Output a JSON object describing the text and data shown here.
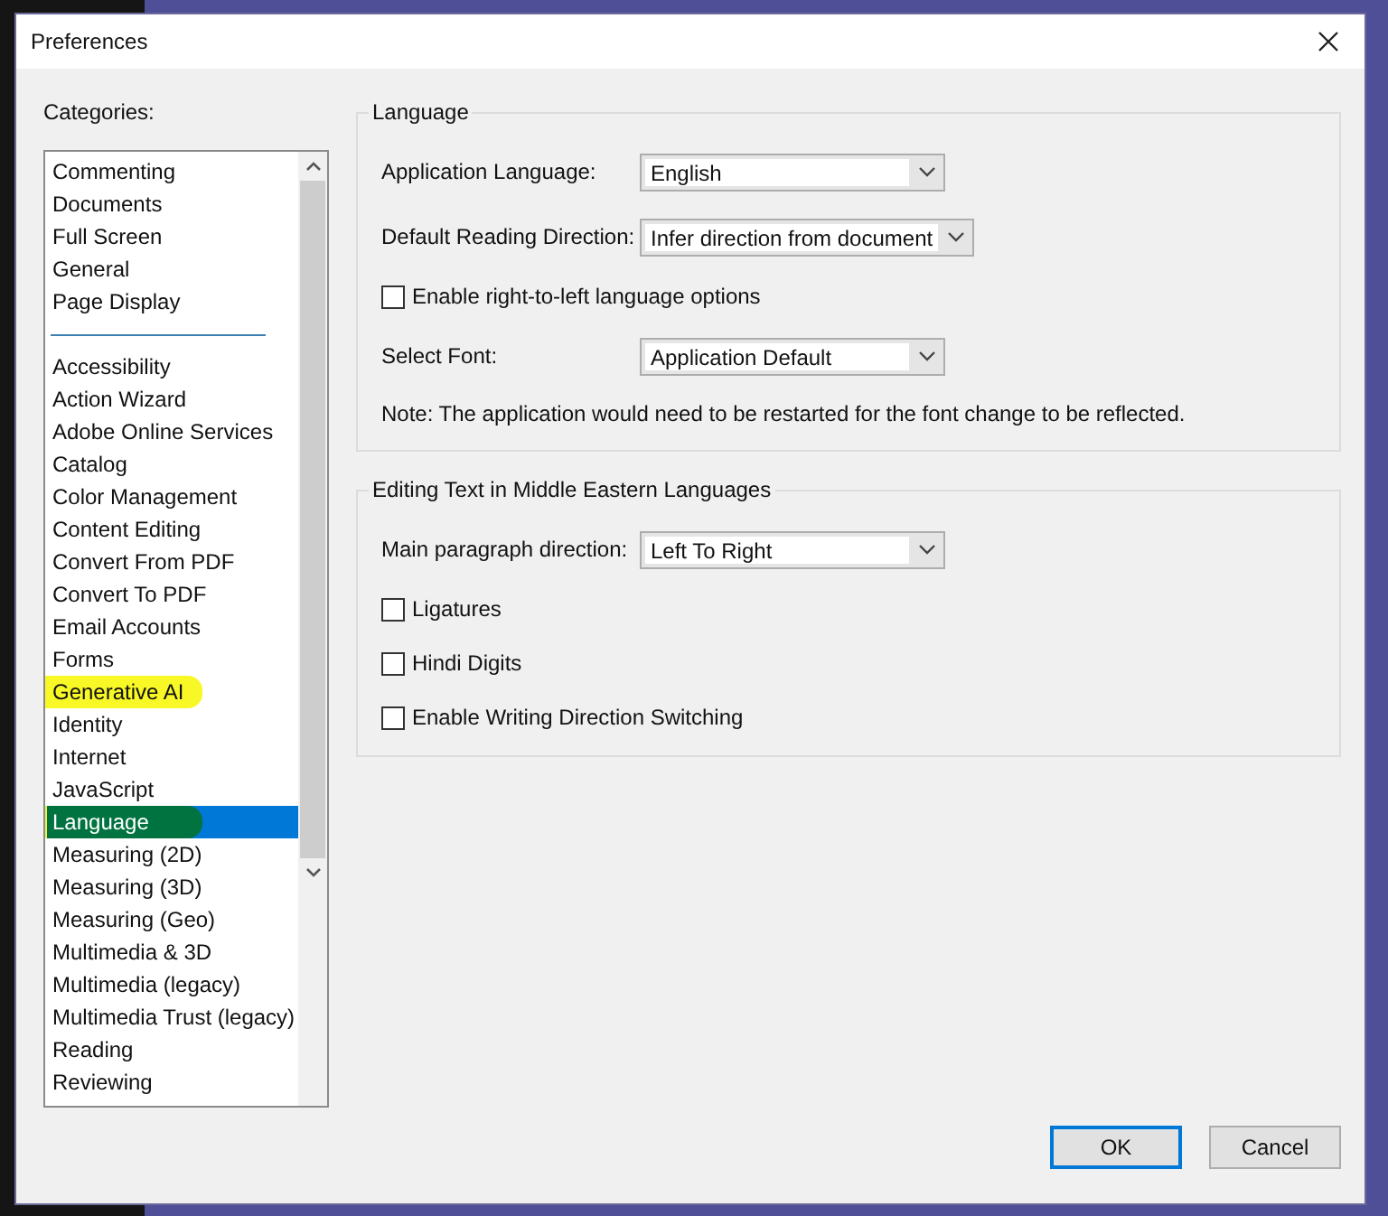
{
  "window": {
    "title": "Preferences"
  },
  "categories": {
    "label": "Categories:",
    "groups": [
      {
        "items": [
          {
            "label": "Commenting",
            "selected": false,
            "highlighted": false
          },
          {
            "label": "Documents",
            "selected": false,
            "highlighted": false
          },
          {
            "label": "Full Screen",
            "selected": false,
            "highlighted": false
          },
          {
            "label": "General",
            "selected": false,
            "highlighted": false
          },
          {
            "label": "Page Display",
            "selected": false,
            "highlighted": false
          }
        ]
      },
      {
        "items": [
          {
            "label": "Accessibility",
            "selected": false,
            "highlighted": false
          },
          {
            "label": "Action Wizard",
            "selected": false,
            "highlighted": false
          },
          {
            "label": "Adobe Online Services",
            "selected": false,
            "highlighted": false
          },
          {
            "label": "Catalog",
            "selected": false,
            "highlighted": false
          },
          {
            "label": "Color Management",
            "selected": false,
            "highlighted": false
          },
          {
            "label": "Content Editing",
            "selected": false,
            "highlighted": false
          },
          {
            "label": "Convert From PDF",
            "selected": false,
            "highlighted": false
          },
          {
            "label": "Convert To PDF",
            "selected": false,
            "highlighted": false
          },
          {
            "label": "Email Accounts",
            "selected": false,
            "highlighted": false
          },
          {
            "label": "Forms",
            "selected": false,
            "highlighted": false
          },
          {
            "label": "Generative AI",
            "selected": false,
            "highlighted": true
          },
          {
            "label": "Identity",
            "selected": false,
            "highlighted": false
          },
          {
            "label": "Internet",
            "selected": false,
            "highlighted": false
          },
          {
            "label": "JavaScript",
            "selected": false,
            "highlighted": false
          },
          {
            "label": "Language",
            "selected": true,
            "highlighted": true
          },
          {
            "label": "Measuring (2D)",
            "selected": false,
            "highlighted": false
          },
          {
            "label": "Measuring (3D)",
            "selected": false,
            "highlighted": false
          },
          {
            "label": "Measuring (Geo)",
            "selected": false,
            "highlighted": false
          },
          {
            "label": "Multimedia & 3D",
            "selected": false,
            "highlighted": false
          },
          {
            "label": "Multimedia (legacy)",
            "selected": false,
            "highlighted": false
          },
          {
            "label": "Multimedia Trust (legacy)",
            "selected": false,
            "highlighted": false
          },
          {
            "label": "Reading",
            "selected": false,
            "highlighted": false
          },
          {
            "label": "Reviewing",
            "selected": false,
            "highlighted": false
          }
        ]
      }
    ]
  },
  "sections": [
    {
      "title": "Language",
      "rows": [
        {
          "kind": "dropdown",
          "label": "Application Language:",
          "value": "English"
        },
        {
          "kind": "dropdown",
          "label": "Default Reading Direction:",
          "value": "Infer direction from document"
        },
        {
          "kind": "checkbox",
          "label": "Enable right-to-left language options",
          "checked": false
        },
        {
          "kind": "dropdown",
          "label": "Select Font:",
          "value": "Application Default"
        },
        {
          "kind": "note",
          "label": "Note: The application would need to be restarted for the font change to be reflected."
        }
      ]
    },
    {
      "title": "Editing Text in Middle Eastern Languages",
      "rows": [
        {
          "kind": "dropdown",
          "label": "Main paragraph direction:",
          "value": "Left To Right"
        },
        {
          "kind": "checkbox",
          "label": "Ligatures",
          "checked": false
        },
        {
          "kind": "checkbox",
          "label": "Hindi Digits",
          "checked": false
        },
        {
          "kind": "checkbox",
          "label": "Enable Writing Direction Switching",
          "checked": false
        }
      ]
    }
  ],
  "buttons": [
    {
      "label": "OK",
      "default": true
    },
    {
      "label": "Cancel",
      "default": false
    }
  ]
}
